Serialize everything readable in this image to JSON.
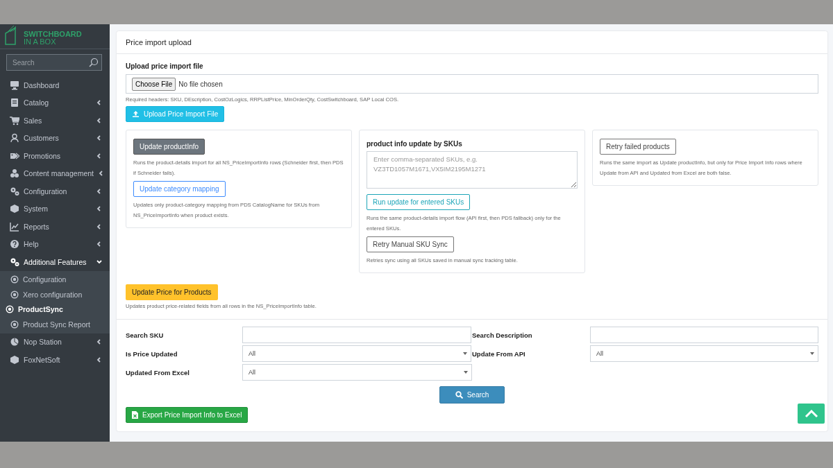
{
  "sidebar": {
    "logo": {
      "line1": "SWITCHBOARD",
      "line2": "IN A BOX"
    },
    "search": {
      "placeholder": "Search"
    },
    "items": [
      {
        "label": "Dashboard",
        "kind": "link",
        "expanded": false
      },
      {
        "label": "Catalog",
        "kind": "group",
        "expanded": false
      },
      {
        "label": "Sales",
        "kind": "group",
        "expanded": false
      },
      {
        "label": "Customers",
        "kind": "group",
        "expanded": false
      },
      {
        "label": "Promotions",
        "kind": "group",
        "expanded": false
      },
      {
        "label": "Content management",
        "kind": "group",
        "expanded": false
      },
      {
        "label": "Configuration",
        "kind": "group",
        "expanded": false
      },
      {
        "label": "System",
        "kind": "group",
        "expanded": false
      },
      {
        "label": "Reports",
        "kind": "group",
        "expanded": false
      },
      {
        "label": "Help",
        "kind": "group",
        "expanded": false
      },
      {
        "label": "Additional Features",
        "kind": "group",
        "expanded": true,
        "children": [
          {
            "label": "Configuration",
            "selected": false
          },
          {
            "label": "Xero configuration",
            "selected": false
          },
          {
            "label": "ProductSync",
            "selected": true
          },
          {
            "label": "Product Sync Report",
            "selected": false
          }
        ]
      },
      {
        "label": "Nop Station",
        "kind": "group",
        "expanded": false
      },
      {
        "label": "FoxNetSoft",
        "kind": "group",
        "expanded": false
      }
    ]
  },
  "card": {
    "title": "Price import upload",
    "upload": {
      "label": "Upload price import file",
      "choose_button": "Choose File",
      "file_status": "No file chosen",
      "hint": "Required headers: SKU, DEscription, CostOzLogics, RRPListPrice, MinOrderQty, CostSwitchboard, SAP Local COS.",
      "button": "Upload Price Import File"
    },
    "panels": [
      {
        "blocks": [
          {
            "kind": "button",
            "text": "Update productInfo"
          },
          {
            "kind": "hint",
            "text": "Runs the product-details import for all NS_PriceImportInfo rows (Schneider first, then PDS if Schneider fails)."
          },
          {
            "kind": "button",
            "text": "Update category mapping"
          },
          {
            "kind": "hint",
            "text": "Updates only product-category mapping from PDS CatalogName for SKUs from NS_PriceImportInfo when product exists."
          }
        ]
      },
      {
        "blocks": [
          {
            "kind": "heading",
            "text": "product info update by SKUs"
          },
          {
            "kind": "textarea",
            "placeholder": "Enter comma-separated SKUs, e.g. VZ3TD1057M1671,VX5IM2195M1271"
          },
          {
            "kind": "button",
            "text": "Run update for entered SKUs"
          },
          {
            "kind": "hint",
            "text": "Runs the same product-details import flow (API first, then PDS fallback) only for the entered SKUs."
          },
          {
            "kind": "button",
            "text": "Retry Manual SKU Sync"
          },
          {
            "kind": "hint",
            "text": "Retries sync using all SKUs saved in manual sync tracking table."
          }
        ]
      },
      {
        "blocks": [
          {
            "kind": "button",
            "text": "Retry failed products"
          },
          {
            "kind": "hint",
            "text": "Runs the same import as Update productInfo, but only for Price Import Info rows where Update from API and Updated from Excel are both false."
          }
        ]
      }
    ],
    "price_button": "Update Price for Products",
    "price_hint": "Updates product price-related fields from all rows in the NS_PriceImportInfo table.",
    "filters": [
      {
        "label": "Search SKU",
        "kind": "text"
      },
      {
        "label": "Search Description",
        "kind": "text"
      },
      {
        "label": "Is Price Updated",
        "kind": "select",
        "value": "All"
      },
      {
        "label": "Update From API",
        "kind": "select",
        "value": "All"
      },
      {
        "label": "Updated From Excel",
        "kind": "select",
        "value": "All"
      }
    ],
    "search_button": "Search",
    "export_button": "Export Price Import Info to Excel"
  }
}
